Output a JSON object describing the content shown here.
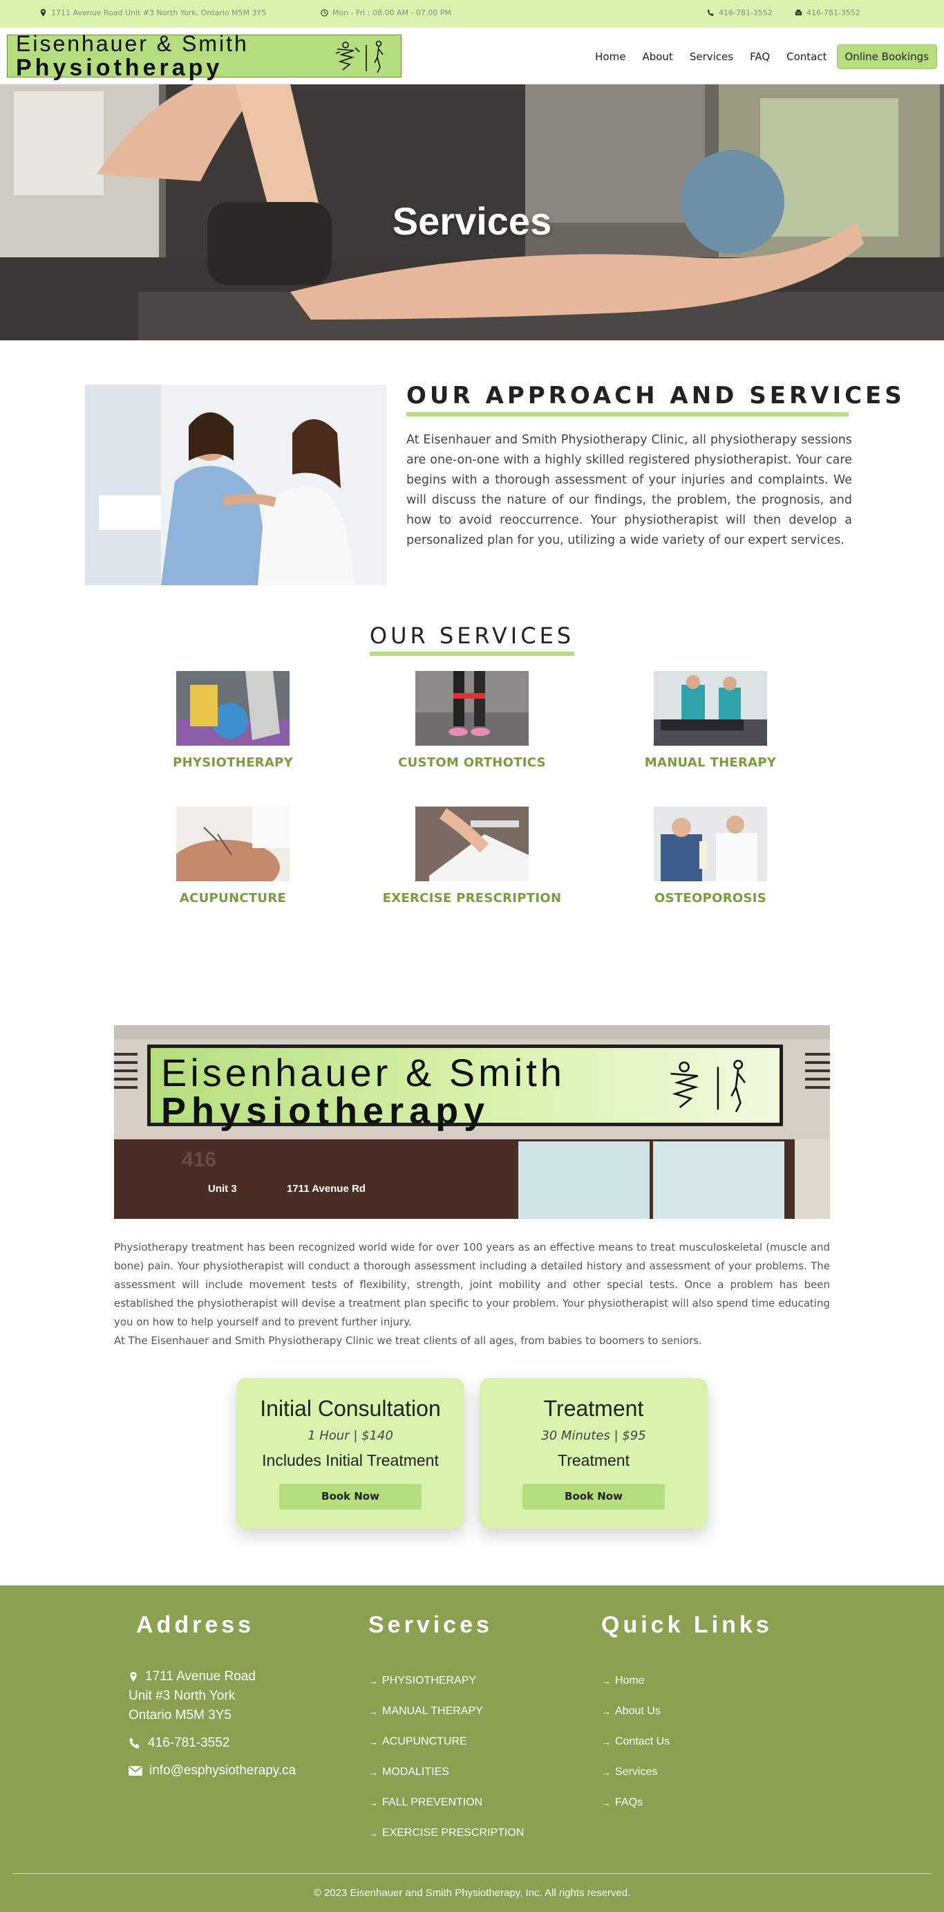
{
  "topbar": {
    "address": "1711 Avenue Road Unit #3 North York, Ontario M5M 3Y5",
    "hours": "Mon - Fri : 08.00 AM - 07.00 PM",
    "phone": "416-781-3552",
    "fax": "416-781-3552"
  },
  "logo": {
    "line1": "Eisenhauer & Smith",
    "line2": "Physiotherapy"
  },
  "nav": {
    "items": [
      "Home",
      "About",
      "Services",
      "FAQ",
      "Contact"
    ],
    "book": "Online Bookings"
  },
  "hero": {
    "title": "Services"
  },
  "approach": {
    "title": "OUR APPROACH AND SERVICES",
    "text": "At Eisenhauer and Smith Physiotherapy Clinic, all physiotherapy sessions are one-on-one with a highly skilled registered physiotherapist. Your care begins with a thorough assessment of your injuries and complaints. We will discuss the nature of our findings, the problem, the prognosis, and how to avoid reoccurrence. Your physiotherapist will then develop a personalized plan for you, utilizing a wide variety of our expert services."
  },
  "services": {
    "title": "OUR SERVICES",
    "items": [
      "PHYSIOTHERAPY",
      "CUSTOM ORTHOTICS",
      "MANUAL THERAPY",
      "ACUPUNCTURE",
      "EXERCISE PRESCRIPTION",
      "OSTEOPOROSIS"
    ]
  },
  "storefront": {
    "line1": "Eisenhauer & Smith",
    "line2": "Physiotherapy",
    "unit": "Unit 3",
    "street": "1711 Avenue Rd",
    "number": "416"
  },
  "paragraph": {
    "p1": "Physiotherapy treatment has been recognized world wide for over 100 years as an effective means to treat musculoskeletal (muscle and bone) pain. Your physiotherapist will conduct a thorough assessment including a detailed history and assessment of your problems. The assessment will include movement tests of flexibility, strength, joint mobility and other special tests. Once a problem has been established the physiotherapist will devise a treatment plan specific to your problem. Your physiotherapist will also spend time educating you on how to help yourself and to prevent further injury.",
    "p2": "At The Eisenhauer and Smith Physiotherapy Clinic we treat clients of all ages, from babies to boomers to seniors."
  },
  "pricing": [
    {
      "title": "Initial Consultation",
      "sub": "1 Hour | $140",
      "inc": "Includes Initial Treatment",
      "btn": "Book Now"
    },
    {
      "title": "Treatment",
      "sub": "30 Minutes | $95",
      "inc": "Treatment",
      "btn": "Book Now"
    }
  ],
  "footer": {
    "address_title": "Address",
    "services_title": "Services",
    "links_title": "Quick Links",
    "address_lines": [
      "1711 Avenue Road",
      "Unit #3 North York",
      "Ontario M5M 3Y5"
    ],
    "phone": "416-781-3552",
    "email": "info@esphysiotherapy.ca",
    "services": [
      "PHYSIOTHERAPY",
      "MANUAL THERAPY",
      "ACUPUNCTURE",
      "MODALITIES",
      "FALL PREVENTION",
      "EXERCISE PRESCRIPTION"
    ],
    "links": [
      "Home",
      "About Us",
      "Contact Us",
      "Services",
      "FAQs"
    ],
    "copyright": "© 2023 Eisenhauer and Smith Physiotherapy, Inc. All rights reserved."
  },
  "colors": {
    "accent": "#b5dd7d",
    "topbar": "#d9f2ae",
    "footer": "#8aa152",
    "service_label": "#7a9b3e"
  }
}
